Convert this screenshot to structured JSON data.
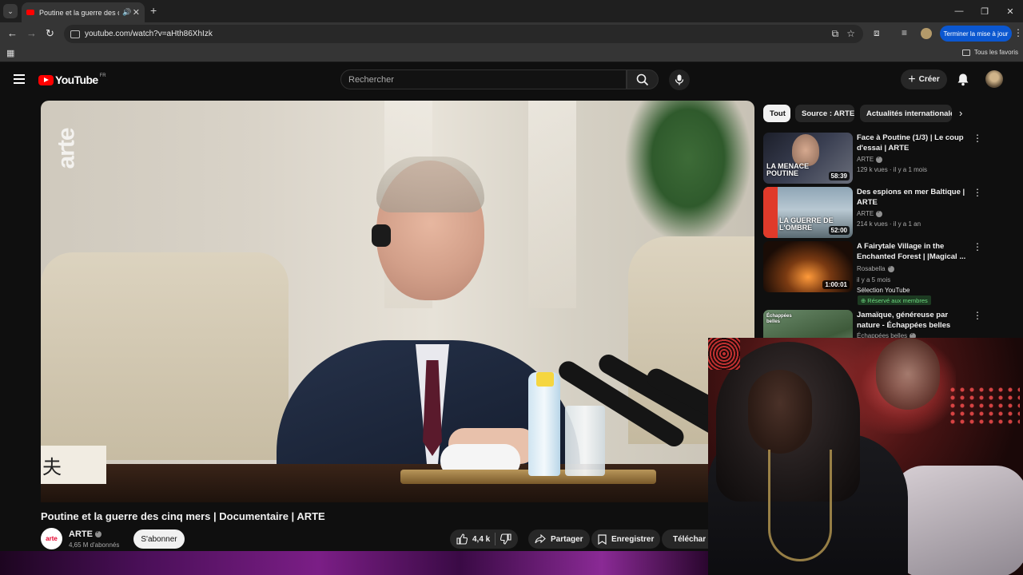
{
  "browser": {
    "tab_title": "Poutine et la guerre des cinq mers | Documentaire | ARTE - YouTube",
    "url": "youtube.com/watch?v=aHth86XhIzk",
    "update_button": "Terminer la mise à jour",
    "all_favorites": "Tous les favoris"
  },
  "youtube": {
    "logo_text": "YouTube",
    "country_code": "FR",
    "search_placeholder": "Rechercher",
    "create_label": "Créer"
  },
  "video": {
    "watermark": "arte",
    "nameplate_text": "夫",
    "title": "Poutine et la guerre des cinq mers | Documentaire | ARTE",
    "channel_avatar_text": "arte",
    "channel": "ARTE",
    "subscribers": "4,65 M d'abonnés",
    "subscribe_label": "S'abonner",
    "likes": "4,4 k",
    "share_label": "Partager",
    "save_label": "Enregistrer",
    "download_label": "Téléchar"
  },
  "chips": [
    "Tout",
    "Source : ARTE",
    "Actualités internationales"
  ],
  "recommendations": [
    {
      "title": "Face à Poutine (1/3) | Le coup d'essai | ARTE",
      "channel": "ARTE",
      "meta": "129 k vues · il y a 1 mois",
      "duration": "58:39",
      "thumb_text": "LA MENACE POUTINE"
    },
    {
      "title": "Des espions en mer Baltique | ARTE",
      "channel": "ARTE",
      "meta": "214 k vues · il y a 1 an",
      "duration": "52:00",
      "thumb_text": "LA GUERRE DE L'OMBRE"
    },
    {
      "title": "A Fairytale Village in the Enchanted Forest | |Magical ...",
      "channel": "Rosabella",
      "meta": "il y a 5 mois",
      "badge": "Sélection YouTube",
      "member": "Réservé aux membres",
      "duration": "1:00:01"
    },
    {
      "title": "Jamaïque, généreuse par nature - Échappées belles",
      "channel": "Échappées belles",
      "thumb_text": "Échappées belles"
    }
  ],
  "colors": {
    "accent_red": "#ff0000",
    "chrome_blue": "#0b57d0",
    "background": "#0f0f0f"
  }
}
